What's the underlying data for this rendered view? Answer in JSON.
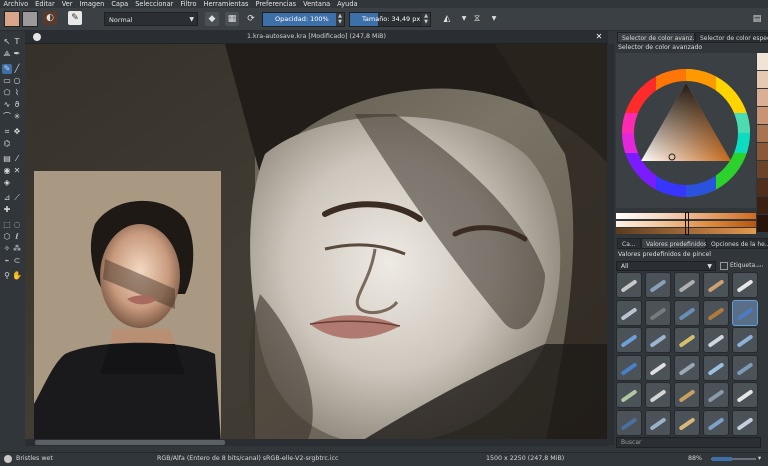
{
  "menubar": {
    "items": [
      "Archivo",
      "Editar",
      "Ver",
      "Imagen",
      "Capa",
      "Seleccionar",
      "Filtro",
      "Herramientas",
      "Preferencias",
      "Ventana",
      "Ayuda"
    ]
  },
  "toolbar": {
    "blend_mode": "Normal",
    "opacity_label": "Opacidad: 100%",
    "opacity_fraction": 1.0,
    "size_label": "Tamaño: 34,49 px",
    "size_fraction": 0.35,
    "foreground_color": "#d9a58a",
    "background_color": "#9a9a9a"
  },
  "document": {
    "title": "1.kra-autosave.kra [Modificado] (247,8 MiB)"
  },
  "docker": {
    "tabs": [
      "Selector de color avanz...",
      "Selector de color especif..."
    ],
    "color_selector_title": "Selector de color avanzado",
    "brush_tabs": [
      "Ca...",
      "Valores predefinidos ...",
      "Opciones de la he..."
    ],
    "brush_title": "Valores predefinidos de pincel",
    "filter_value": "All",
    "tag_label": "Etiqueta...",
    "search_placeholder": "Buscar",
    "selected_hue_color": "#c86a1c"
  },
  "status": {
    "brush_name": "Bristles wet",
    "color_model": "RGB/Alfa (Entero de 8 bits/canal)  sRGB-elle-V2-srgbtrc.icc",
    "dimensions": "1500 x 2250 (247,8 MiB)",
    "zoom": "88%"
  },
  "swatch_colors": [
    "#f1e3d6",
    "#e6c9b3",
    "#d9b093",
    "#c79573",
    "#a8744f",
    "#8a5a38",
    "#6b4328",
    "#4f2f1c",
    "#3a2114",
    "#27150c"
  ],
  "preset_colors": [
    "#c9c9c9",
    "#8aa0b8",
    "#b0b0b0",
    "#d0a070",
    "#e6e6e6",
    "#b9c4d0",
    "#7a7a7a",
    "#6a8fb7",
    "#b47a3c",
    "#4d7ac4",
    "#6ea0d8",
    "#9fb5cf",
    "#d8c06a",
    "#cfd6df",
    "#8fb0d8",
    "#4a80c8",
    "#e0e0e0",
    "#9aa8b8",
    "#9cc0e0",
    "#7e9ab8",
    "#b0c8a0",
    "#d4d4d4",
    "#c8a060",
    "#8a9aaa",
    "#e6e6e6",
    "#4a6fa0",
    "#9ab0c8",
    "#d8b878",
    "#7ca0c8",
    "#c4d0dc"
  ]
}
